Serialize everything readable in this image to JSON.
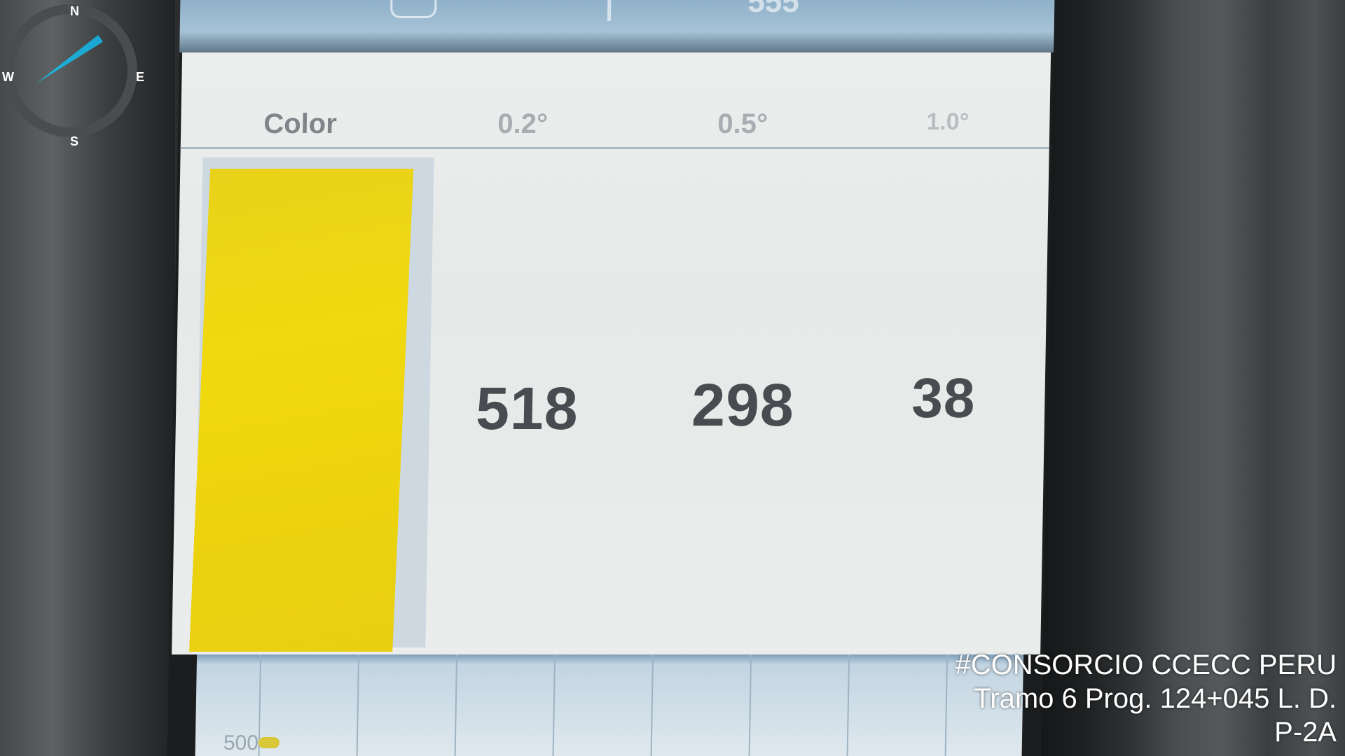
{
  "compass": {
    "north": "N",
    "east": "E",
    "south": "S",
    "west": "W"
  },
  "screen": {
    "top_partial_text": "555",
    "headers": {
      "color": "Color",
      "angle_1": "0.2°",
      "angle_2": "0.5°",
      "angle_3": "1.0°"
    },
    "swatch_color": "#ecd30e",
    "values": {
      "angle_1": "518",
      "angle_2": "298",
      "angle_3": "38"
    },
    "graph_label": "500"
  },
  "watermark": {
    "line1": "#CONSORCIO CCECC PERU",
    "line2": "Tramo 6 Prog. 124+045 L. D.",
    "line3": "P-2A"
  }
}
